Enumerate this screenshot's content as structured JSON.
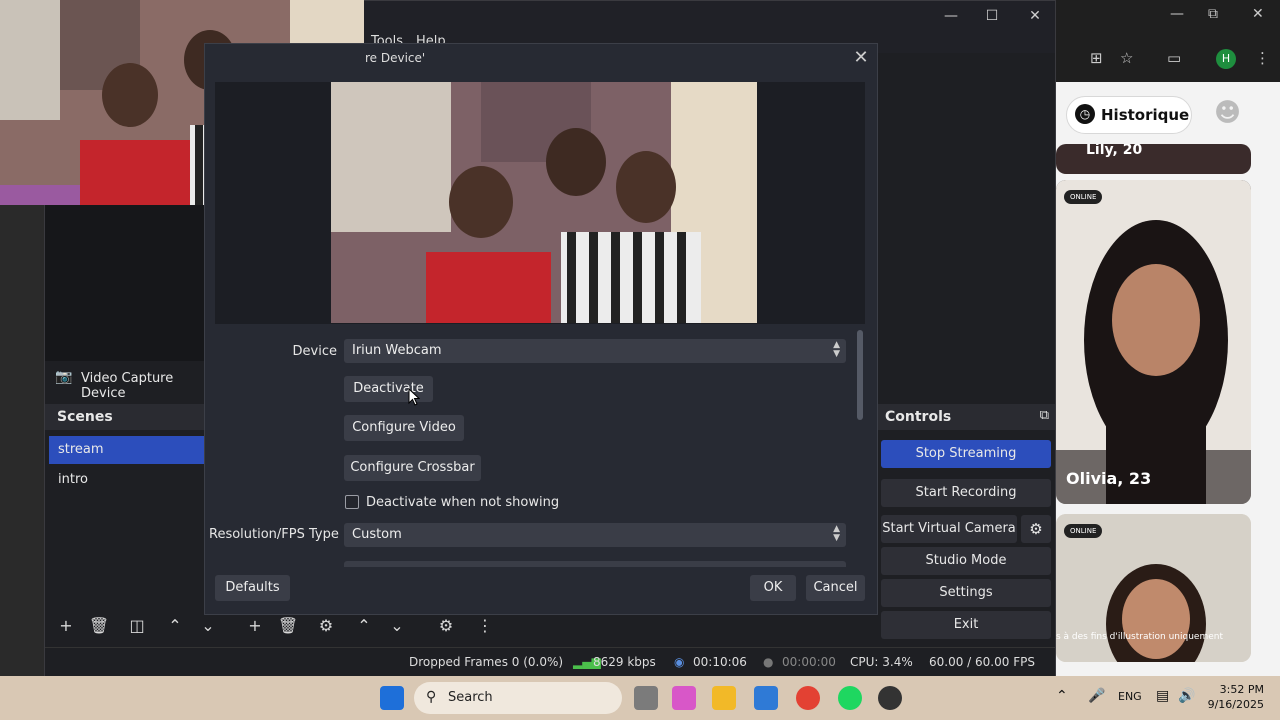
{
  "obs": {
    "menu": [
      "Tools",
      "Help"
    ],
    "source_label": "Video Capture Device",
    "scenes_title": "Scenes",
    "scenes": [
      "stream",
      "intro"
    ],
    "controls_title": "Controls",
    "controls": {
      "stop_streaming": "Stop Streaming",
      "start_recording": "Start Recording",
      "start_virtual_camera": "Start Virtual Camera",
      "studio_mode": "Studio Mode",
      "settings": "Settings",
      "exit": "Exit"
    },
    "status": {
      "dropped_frames": "Dropped Frames 0 (0.0%)",
      "bitrate": "8629 kbps",
      "stream_time": "00:10:06",
      "record_time": "00:00:00",
      "cpu": "CPU: 3.4%",
      "fps": "60.00 / 60.00 FPS"
    }
  },
  "dialog": {
    "title": "re Device'",
    "device_label": "Device",
    "device_value": "Iriun Webcam",
    "deactivate": "Deactivate",
    "configure_video": "Configure Video",
    "configure_crossbar": "Configure Crossbar",
    "deactivate_when_not_showing": "Deactivate when not showing",
    "deactivate_when_not_showing_checked": false,
    "resolution_label": "Resolution/FPS Type",
    "resolution_value": "Custom",
    "defaults": "Defaults",
    "ok": "OK",
    "cancel": "Cancel"
  },
  "browser": {
    "profile_initial": "H",
    "historique": "Historique",
    "partial_name": "Lily, 20",
    "online": "ONLINE",
    "olivia": "Olivia, 23",
    "disclaimer": "s à des fins d'illustration uniquement"
  },
  "taskbar": {
    "search": "Search",
    "language": "ENG",
    "time": "3:52 PM",
    "date": "9/16/2025"
  },
  "colors": {
    "accent": "#2c4ebc",
    "obs_bg": "#1e1f23",
    "dialog_bg": "#272a33"
  }
}
